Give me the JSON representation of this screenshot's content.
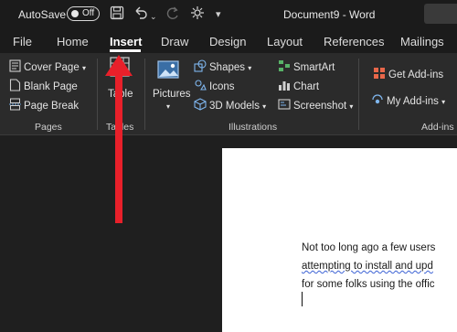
{
  "titlebar": {
    "autosave_label": "AutoSave",
    "autosave_state": "Off",
    "document_title": "Document9 - Word",
    "icons": [
      "save-icon",
      "undo-icon",
      "redo-icon",
      "touch-mode-icon",
      "customize-icon"
    ]
  },
  "tabs": [
    "File",
    "Home",
    "Insert",
    "Draw",
    "Design",
    "Layout",
    "References",
    "Mailings"
  ],
  "active_tab": "Insert",
  "ribbon": {
    "pages": {
      "label": "Pages",
      "cover_page": "Cover Page",
      "blank_page": "Blank Page",
      "page_break": "Page Break"
    },
    "tables": {
      "label": "Tables",
      "table": "Table"
    },
    "illustrations": {
      "label": "Illustrations",
      "pictures": "Pictures",
      "shapes": "Shapes",
      "icons": "Icons",
      "models": "3D Models",
      "smartart": "SmartArt",
      "chart": "Chart",
      "screenshot": "Screenshot"
    },
    "addins": {
      "label": "Add-ins",
      "get": "Get Add-ins",
      "my": "My Add-ins"
    }
  },
  "document": {
    "line1": "Not too long ago a few users",
    "line2": "attempting to install and upd",
    "line3": "for some folks using the offic"
  },
  "colors": {
    "arrow": "#e8202a",
    "accent": "#3b61d4"
  }
}
